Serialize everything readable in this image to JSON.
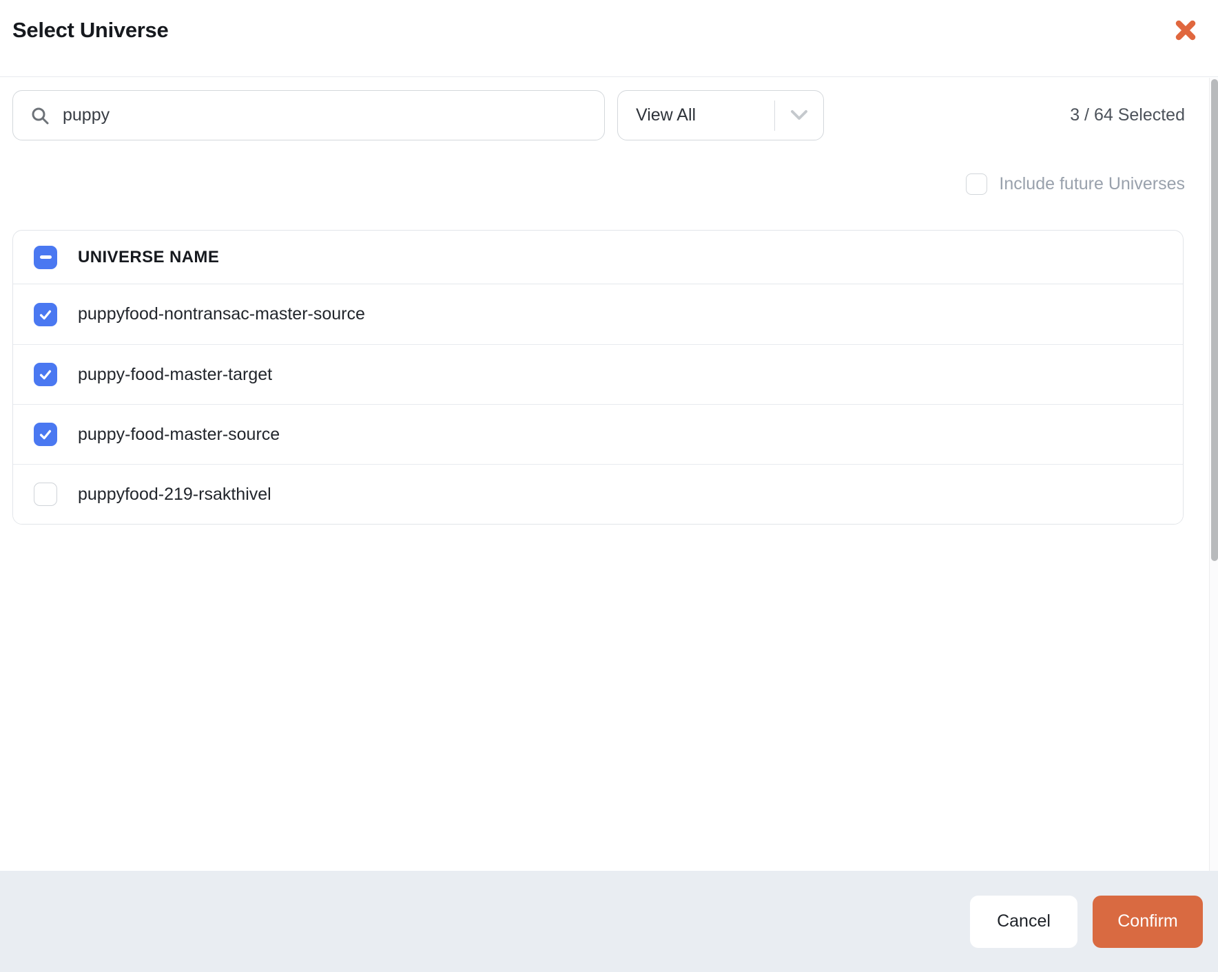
{
  "modal": {
    "title": "Select Universe"
  },
  "toolbar": {
    "search": {
      "value": "puppy",
      "placeholder": ""
    },
    "filter": {
      "selected_value": "View All"
    },
    "selection_count": "3 / 64 Selected",
    "include_future": {
      "label": "Include future Universes",
      "checked": false
    }
  },
  "table": {
    "header": {
      "name_column": "UNIVERSE NAME",
      "select_all_state": "indeterminate"
    },
    "rows": [
      {
        "name": "puppyfood-nontransac-master-source",
        "checked": true
      },
      {
        "name": "puppy-food-master-target",
        "checked": true
      },
      {
        "name": "puppy-food-master-source",
        "checked": true
      },
      {
        "name": "puppyfood-219-rsakthivel",
        "checked": false
      }
    ]
  },
  "footer": {
    "cancel_label": "Cancel",
    "confirm_label": "Confirm"
  },
  "icons": {
    "close": "x-mark",
    "search": "magnifier",
    "dropdown": "chevron-down",
    "checked": "check-mark",
    "select_all": "minus-bar"
  },
  "colors": {
    "accent_orange": "#D96A41",
    "close_icon_orange": "#E0673E",
    "checkbox_blue": "#4A78F1",
    "footer_background": "#E9EDF2"
  }
}
